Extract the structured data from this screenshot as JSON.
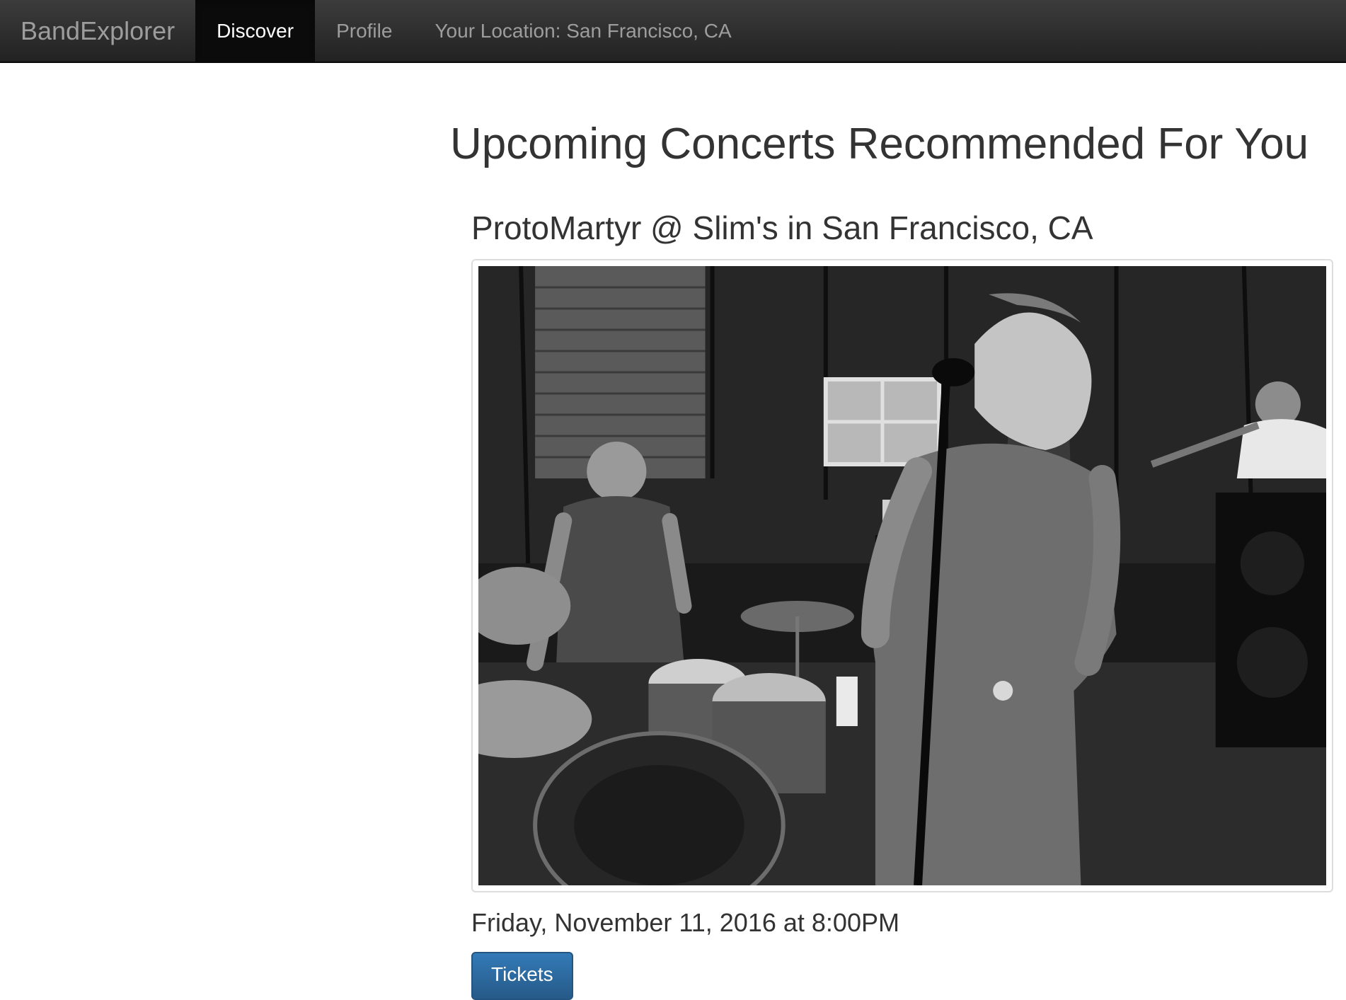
{
  "navbar": {
    "brand": "BandExplorer",
    "items": [
      {
        "label": "Discover",
        "active": true
      },
      {
        "label": "Profile",
        "active": false
      }
    ],
    "location": "Your Location: San Francisco, CA"
  },
  "main": {
    "heading": "Upcoming Concerts Recommended For You",
    "concerts": [
      {
        "title": "ProtoMartyr @ Slim's in San Francisco, CA",
        "date": "Friday, November 11, 2016 at 8:00PM",
        "tickets_label": "Tickets",
        "photo_icon": "band-photo"
      }
    ]
  },
  "colors": {
    "navbar_bg": "#222222",
    "navbar_text": "#9d9d9d",
    "active_text": "#ffffff",
    "heading_text": "#333333",
    "button_bg": "#337ab7"
  }
}
